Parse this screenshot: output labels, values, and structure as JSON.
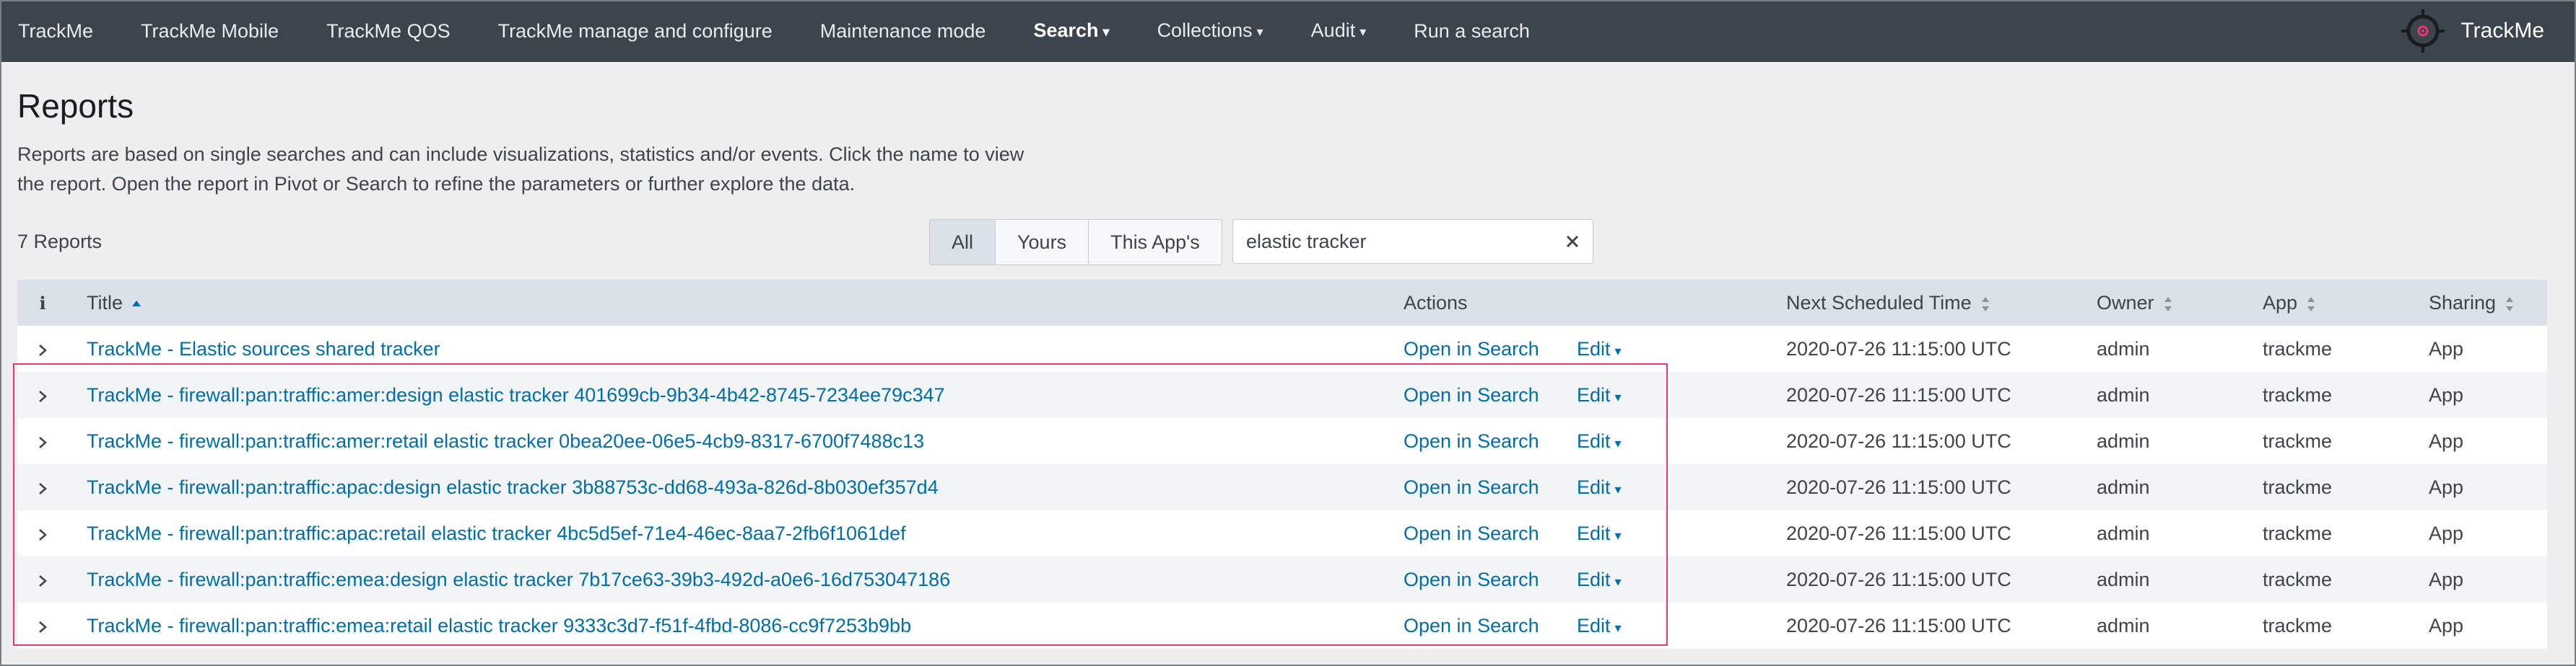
{
  "nav": {
    "items": [
      {
        "label": "TrackMe",
        "dropdown": false,
        "active": false
      },
      {
        "label": "TrackMe Mobile",
        "dropdown": false,
        "active": false
      },
      {
        "label": "TrackMe QOS",
        "dropdown": false,
        "active": false
      },
      {
        "label": "TrackMe manage and configure",
        "dropdown": false,
        "active": false
      },
      {
        "label": "Maintenance mode",
        "dropdown": false,
        "active": false
      },
      {
        "label": "Search",
        "dropdown": true,
        "active": true
      },
      {
        "label": "Collections",
        "dropdown": true,
        "active": false
      },
      {
        "label": "Audit",
        "dropdown": true,
        "active": false
      },
      {
        "label": "Run a search",
        "dropdown": false,
        "active": false
      }
    ],
    "brand": {
      "name": "TrackMe",
      "logo_icon": "crosshair-target-icon",
      "accent": "#e8386d"
    }
  },
  "header": {
    "title": "Reports",
    "description": "Reports are based on single searches and can include visualizations, statistics and/or events. Click the name to view the report. Open the report in Pivot or Search to refine the parameters or further explore the data."
  },
  "controls": {
    "count": "7 Reports",
    "filters": [
      {
        "label": "All",
        "selected": true
      },
      {
        "label": "Yours",
        "selected": false
      },
      {
        "label": "This App's",
        "selected": false
      }
    ],
    "search": {
      "value": "elastic tracker",
      "placeholder": "filter"
    }
  },
  "table": {
    "columns": {
      "info": "i",
      "title": "Title",
      "actions": "Actions",
      "next": "Next Scheduled Time",
      "owner": "Owner",
      "app": "App",
      "sharing": "Sharing"
    },
    "rows": [
      {
        "title": "TrackMe - Elastic sources shared tracker",
        "action": "Open in Search",
        "edit": "Edit",
        "next": "2020-07-26 11:15:00 UTC",
        "owner": "admin",
        "app": "trackme",
        "sharing": "App"
      },
      {
        "title": "TrackMe - firewall:pan:traffic:amer:design elastic tracker 401699cb-9b34-4b42-8745-7234ee79c347",
        "action": "Open in Search",
        "edit": "Edit",
        "next": "2020-07-26 11:15:00 UTC",
        "owner": "admin",
        "app": "trackme",
        "sharing": "App"
      },
      {
        "title": "TrackMe - firewall:pan:traffic:amer:retail elastic tracker 0bea20ee-06e5-4cb9-8317-6700f7488c13",
        "action": "Open in Search",
        "edit": "Edit",
        "next": "2020-07-26 11:15:00 UTC",
        "owner": "admin",
        "app": "trackme",
        "sharing": "App"
      },
      {
        "title": "TrackMe - firewall:pan:traffic:apac:design elastic tracker 3b88753c-dd68-493a-826d-8b030ef357d4",
        "action": "Open in Search",
        "edit": "Edit",
        "next": "2020-07-26 11:15:00 UTC",
        "owner": "admin",
        "app": "trackme",
        "sharing": "App"
      },
      {
        "title": "TrackMe - firewall:pan:traffic:apac:retail elastic tracker 4bc5d5ef-71e4-46ec-8aa7-2fb6f1061def",
        "action": "Open in Search",
        "edit": "Edit",
        "next": "2020-07-26 11:15:00 UTC",
        "owner": "admin",
        "app": "trackme",
        "sharing": "App"
      },
      {
        "title": "TrackMe - firewall:pan:traffic:emea:design elastic tracker 7b17ce63-39b3-492d-a0e6-16d753047186",
        "action": "Open in Search",
        "edit": "Edit",
        "next": "2020-07-26 11:15:00 UTC",
        "owner": "admin",
        "app": "trackme",
        "sharing": "App"
      },
      {
        "title": "TrackMe - firewall:pan:traffic:emea:retail elastic tracker 9333c3d7-f51f-4fbd-8086-cc9f7253b9bb",
        "action": "Open in Search",
        "edit": "Edit",
        "next": "2020-07-26 11:15:00 UTC",
        "owner": "admin",
        "app": "trackme",
        "sharing": "App"
      }
    ]
  },
  "colors": {
    "nav_bg": "#3c444d",
    "link": "#006eaa",
    "highlight": "#e8386d",
    "header_bg": "#dbe1e8"
  }
}
